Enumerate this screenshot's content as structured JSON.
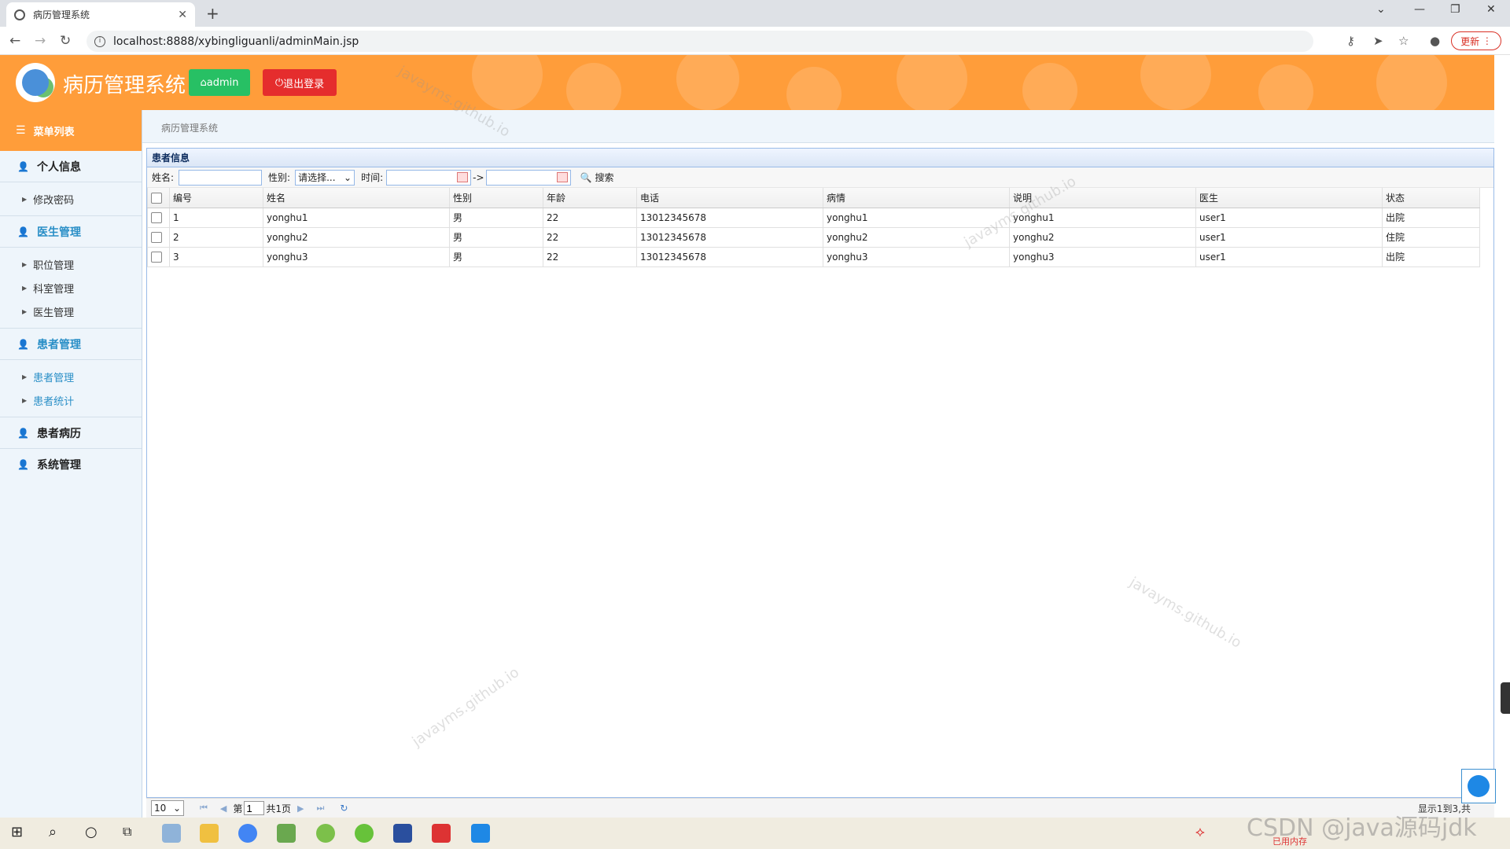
{
  "browser": {
    "tab_title": "病历管理系统",
    "url": "localhost:8888/xybingliguanli/adminMain.jsp",
    "update_label": "更新"
  },
  "header": {
    "app_title": "病历管理系统",
    "admin_label": "admin",
    "logout_label": "退出登录"
  },
  "sidebar": {
    "menu_title": "菜单列表",
    "groups": [
      {
        "label": "个人信息",
        "items": [
          "修改密码"
        ]
      },
      {
        "label": "医生管理",
        "items": [
          "职位管理",
          "科室管理",
          "医生管理"
        ]
      },
      {
        "label": "患者管理",
        "items": [
          "患者管理",
          "患者统计"
        ]
      },
      {
        "label": "患者病历",
        "items": []
      },
      {
        "label": "系统管理",
        "items": []
      }
    ]
  },
  "breadcrumb": "病历管理系统",
  "panel": {
    "title": "患者信息",
    "filters": {
      "name_label": "姓名:",
      "gender_label": "性别:",
      "gender_value": "请选择...",
      "time_label": "时间:",
      "arrow": "->",
      "search_label": "搜索"
    },
    "columns": [
      "编号",
      "姓名",
      "性别",
      "年龄",
      "电话",
      "病情",
      "说明",
      "医生",
      "状态"
    ],
    "rows": [
      [
        "1",
        "yonghu1",
        "男",
        "22",
        "13012345678",
        "yonghu1",
        "yonghu1",
        "user1",
        "出院"
      ],
      [
        "2",
        "yonghu2",
        "男",
        "22",
        "13012345678",
        "yonghu2",
        "yonghu2",
        "user1",
        "住院"
      ],
      [
        "3",
        "yonghu3",
        "男",
        "22",
        "13012345678",
        "yonghu3",
        "yonghu3",
        "user1",
        "出院"
      ]
    ]
  },
  "pager": {
    "page_size": "10",
    "page_prefix": "第",
    "page_number": "1",
    "page_total": "共1页",
    "info": "显示1到3,共"
  },
  "watermark": "javayms.github.io",
  "taskbar": {
    "memory_label": "已用内存"
  },
  "overlay": {
    "csdn": "CSDN @java源码jdk"
  },
  "colors": {
    "header": "#ff9d3a",
    "admin": "#27c064",
    "logout": "#e52d2d",
    "accent": "#2a8fc7"
  }
}
